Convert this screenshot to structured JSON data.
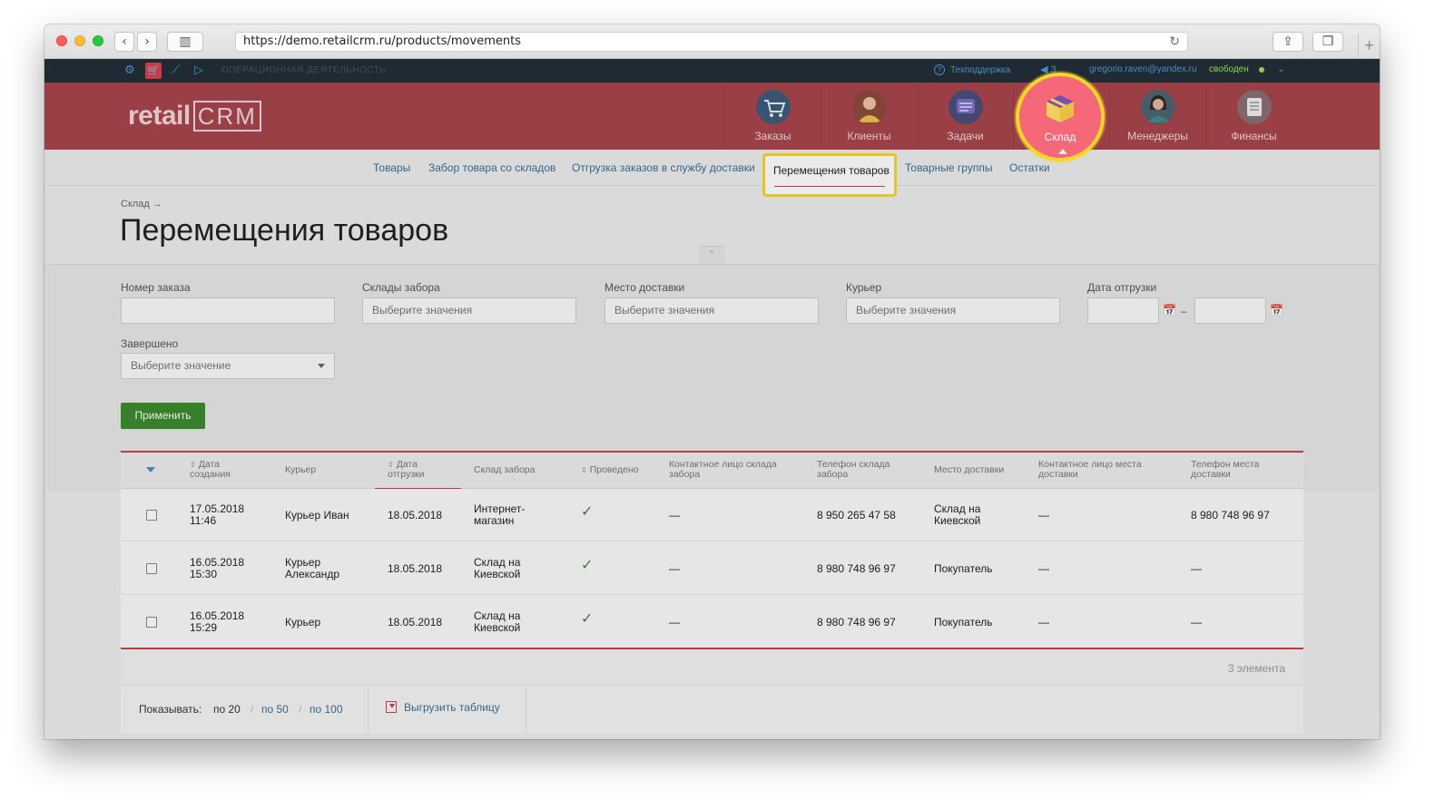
{
  "browser": {
    "url": "https://demo.retailcrm.ru/products/movements",
    "back": "‹",
    "forward": "›"
  },
  "topbar": {
    "section": "ОПЕРАЦИОННАЯ ДЕЯТЕЛЬНОСТЬ",
    "support": "Техподдержка",
    "notifications": "3",
    "email": "gregorio.raven@yandex.ru",
    "status": "свободен"
  },
  "logo": {
    "retail": "retail",
    "crm": "CRM"
  },
  "nav": {
    "items": [
      {
        "label": "Заказы",
        "color": "#3e5c7a"
      },
      {
        "label": "Клиенты",
        "color": "#8c4a3c"
      },
      {
        "label": "Задачи",
        "color": "#4a4f7a"
      },
      {
        "label": "Склад",
        "color": "#f4687a"
      },
      {
        "label": "Менеджеры",
        "color": "#4f6470"
      },
      {
        "label": "Финансы",
        "color": "#8a6f73"
      }
    ]
  },
  "subnav": {
    "items": [
      "Товары",
      "Забор товара со складов",
      "Отгрузка заказов в службу доставки",
      "Перемещения товаров",
      "Товарные группы",
      "Остатки"
    ],
    "active": "Перемещения товаров"
  },
  "breadcrumb": "Склад →",
  "page_title": "Перемещения товаров",
  "filters": {
    "order_number": {
      "label": "Номер заказа",
      "value": ""
    },
    "pickup_warehouses": {
      "label": "Склады забора",
      "placeholder": "Выберите значения"
    },
    "delivery_place": {
      "label": "Место доставки",
      "placeholder": "Выберите значения"
    },
    "courier": {
      "label": "Курьер",
      "placeholder": "Выберите значения"
    },
    "ship_date": {
      "label": "Дата отгрузки",
      "separator": "–"
    },
    "completed": {
      "label": "Завершено",
      "placeholder": "Выберите значение"
    },
    "apply_label": "Применить"
  },
  "table": {
    "headers": {
      "created": [
        "Дата",
        "создания"
      ],
      "courier": "Курьер",
      "ship_date": [
        "Дата",
        "отгрузки"
      ],
      "pickup_warehouse": "Склад забора",
      "posted": "Проведено",
      "pickup_contact": [
        "Контактное лицо склада",
        "забора"
      ],
      "pickup_phone": [
        "Телефон склада",
        "забора"
      ],
      "delivery_place": "Место доставки",
      "delivery_contact": [
        "Контактное лицо места",
        "доставки"
      ],
      "delivery_phone": [
        "Телефон места",
        "доставки"
      ]
    },
    "rows": [
      {
        "created": [
          "17.05.2018",
          "11:46"
        ],
        "courier": [
          "Курьер Иван"
        ],
        "ship_date": "18.05.2018",
        "pickup_warehouse": [
          "Интернет-",
          "магазин"
        ],
        "posted": "✓",
        "pickup_contact": "—",
        "pickup_phone": "8 950 265 47 58",
        "delivery_place": [
          "Склад на",
          "Киевской"
        ],
        "delivery_contact": "—",
        "delivery_phone": "8 980 748 96 97"
      },
      {
        "created": [
          "16.05.2018",
          "15:30"
        ],
        "courier": [
          "Курьер",
          "Александр"
        ],
        "ship_date": "18.05.2018",
        "pickup_warehouse": [
          "Склад на",
          "Киевской"
        ],
        "posted": "✓",
        "pickup_contact": "—",
        "pickup_phone": "8 980 748 96 97",
        "delivery_place": [
          "Покупатель"
        ],
        "delivery_contact": "—",
        "delivery_phone": "—"
      },
      {
        "created": [
          "16.05.2018",
          "15:29"
        ],
        "courier": [
          "Курьер"
        ],
        "ship_date": "18.05.2018",
        "pickup_warehouse": [
          "Склад на",
          "Киевской"
        ],
        "posted": "✓",
        "pickup_contact": "—",
        "pickup_phone": "8 980 748 96 97",
        "delivery_place": [
          "Покупатель"
        ],
        "delivery_contact": "—",
        "delivery_phone": "—"
      }
    ],
    "count": "3 элемента"
  },
  "pager": {
    "label": "Показывать:",
    "options": [
      "по 20",
      "по 50",
      "по 100"
    ],
    "selected": "по 20",
    "export": "Выгрузить таблицу"
  },
  "colors": {
    "header": "#a9454c",
    "accent": "#c7434d",
    "highlight": "#f7d627",
    "apply": "#3c8a2e",
    "link": "#3c6e93"
  }
}
